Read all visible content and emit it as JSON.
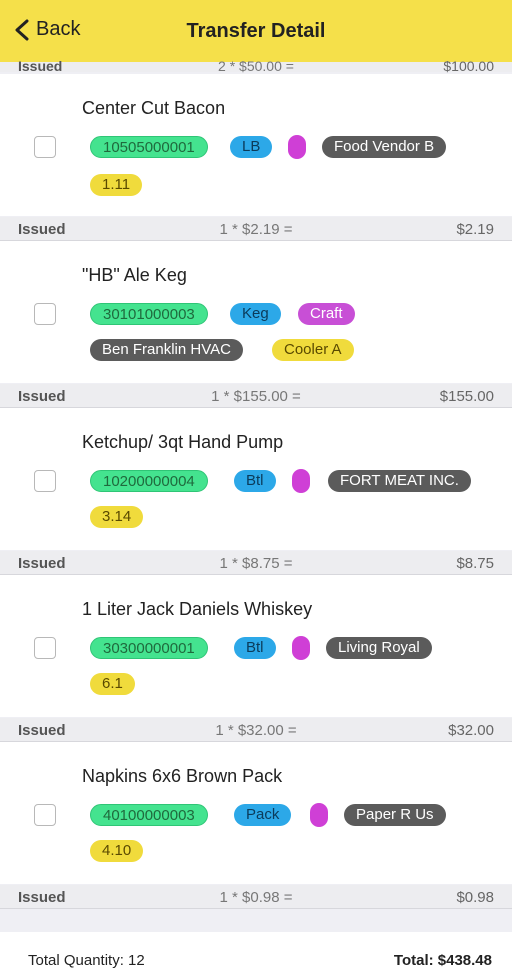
{
  "header": {
    "back_label": "Back",
    "title": "Transfer Detail"
  },
  "top_summary": {
    "status": "Issued",
    "formula": "2 * $50.00 =",
    "amount": "$100.00"
  },
  "items": [
    {
      "name": "Center Cut Bacon",
      "code": "10505000001",
      "unit": "LB",
      "vendor": "Food Vendor B",
      "category": "1.11",
      "summary": {
        "status": "Issued",
        "formula": "1 * $2.19 =",
        "amount": "$2.19"
      }
    },
    {
      "name": "\"HB\" Ale Keg",
      "code": "30101000003",
      "unit": "Keg",
      "craft": "Craft",
      "vendor": "Ben Franklin HVAC",
      "location": "Cooler A",
      "summary": {
        "status": "Issued",
        "formula": "1 * $155.00 =",
        "amount": "$155.00"
      }
    },
    {
      "name": "Ketchup/ 3qt Hand Pump",
      "code": "10200000004",
      "unit": "Btl",
      "vendor": "FORT MEAT INC.",
      "category": "3.14",
      "summary": {
        "status": "Issued",
        "formula": "1 * $8.75 =",
        "amount": "$8.75"
      }
    },
    {
      "name": "1 Liter Jack Daniels Whiskey",
      "code": "30300000001",
      "unit": "Btl",
      "vendor": "Living Royal",
      "category": "6.1",
      "summary": {
        "status": "Issued",
        "formula": "1 * $32.00 =",
        "amount": "$32.00"
      }
    },
    {
      "name": "Napkins 6x6 Brown Pack",
      "code": "40100000003",
      "unit": "Pack",
      "vendor": "Paper R Us",
      "category": "4.10",
      "summary": {
        "status": "Issued",
        "formula": "1 * $0.98 =",
        "amount": "$0.98"
      }
    }
  ],
  "footer": {
    "total_quantity": "Total Quantity: 12",
    "total": "Total: $438.48"
  },
  "colors": {
    "header_bg": "#f5e04a",
    "code_tag": "#44e38f",
    "unit_tag": "#2ca8e8",
    "vendor_tag": "#5b5b5b",
    "category_tag": "#f0db3c",
    "craft_tag": "#c84fd6"
  }
}
